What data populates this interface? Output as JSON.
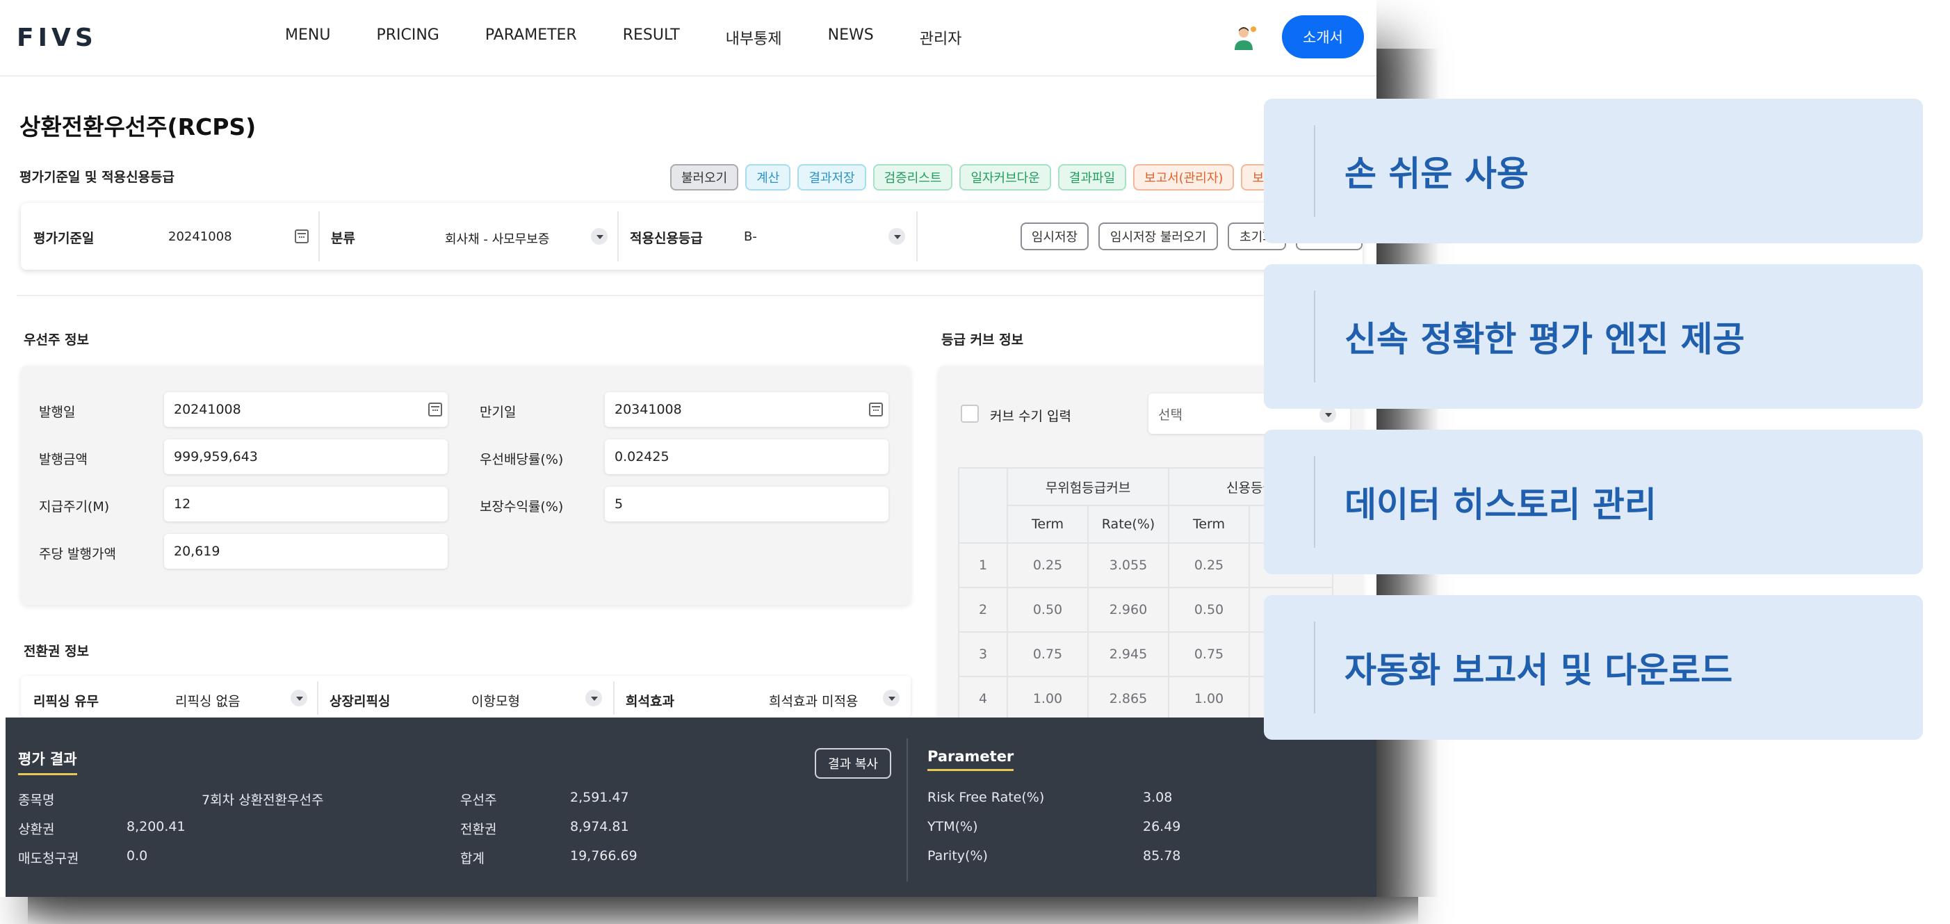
{
  "app": {
    "logo": "FIVS",
    "nav": [
      "MENU",
      "PRICING",
      "PARAMETER",
      "RESULT",
      "내부통제",
      "NEWS",
      "관리자"
    ],
    "intro_button": "소개서"
  },
  "page": {
    "title": "상환전환우선주(RCPS)",
    "section_top": "평가기준일 및 적용신용등급",
    "chips": [
      {
        "label": "불러오기",
        "style": "gray"
      },
      {
        "label": "계산",
        "style": "cyan"
      },
      {
        "label": "결과저장",
        "style": "cyan"
      },
      {
        "label": "검증리스트",
        "style": "green"
      },
      {
        "label": "일자커브다운",
        "style": "green"
      },
      {
        "label": "결과파일",
        "style": "green"
      },
      {
        "label": "보고서(관리자)",
        "style": "orange"
      },
      {
        "label": "보고서",
        "style": "orange"
      }
    ],
    "filter": {
      "eval_date_label": "평가기준일",
      "eval_date_value": "20241008",
      "category_label": "분류",
      "category_value": "회사채 - 사모무보증",
      "credit_label": "적용신용등급",
      "credit_value": "B-",
      "buttons": [
        "임시저장",
        "임시저장 불러오기",
        "초기화"
      ]
    },
    "preferred": {
      "title": "우선주 정보",
      "issue_date_label": "발행일",
      "issue_date_value": "20241008",
      "maturity_label": "만기일",
      "maturity_value": "20341008",
      "issue_amount_label": "발행금액",
      "issue_amount_value": "999,959,643",
      "dividend_label": "우선배당률(%)",
      "dividend_value": "0.02425",
      "period_label": "지급주기(M)",
      "period_value": "12",
      "guarantee_label": "보장수익률(%)",
      "guarantee_value": "5",
      "price_label": "주당 발행가액",
      "price_value": "20,619"
    },
    "grade_curve": {
      "title": "등급 커브 정보",
      "manual_label": "커브 수기 입력",
      "select_placeholder": "선택",
      "group1": "무위험등급커브",
      "group2": "신용등급",
      "col_term": "Term",
      "col_rate": "Rate(%)",
      "rows": [
        {
          "n": "1",
          "t1": "0.25",
          "r1": "3.055",
          "t2": "0.25"
        },
        {
          "n": "2",
          "t1": "0.50",
          "r1": "2.960",
          "t2": "0.50"
        },
        {
          "n": "3",
          "t1": "0.75",
          "r1": "2.945",
          "t2": "0.75"
        },
        {
          "n": "4",
          "t1": "1.00",
          "r1": "2.865",
          "t2": "1.00"
        }
      ]
    },
    "conversion": {
      "title": "전환권 정보",
      "refixing_label": "리픽싱 유무",
      "refixing_value": "리픽싱 없음",
      "listed_label": "상장리픽싱",
      "listed_value": "이항모형",
      "dilution_label": "희석효과",
      "dilution_value": "희석효과 미적용"
    }
  },
  "result": {
    "title": "평가 결과",
    "copy_button": "결과 복사",
    "name_label": "종목명",
    "name_value": "7회차 상환전환우선주",
    "preferred_label": "우선주",
    "preferred_value": "2,591.47",
    "redemption_label": "상환권",
    "redemption_value": "8,200.41",
    "conversion_label": "전환권",
    "conversion_value": "8,974.81",
    "put_label": "매도청구권",
    "put_value": "0.0",
    "total_label": "합계",
    "total_value": "19,766.69",
    "param_title": "Parameter",
    "rf_label": "Risk Free Rate(%)",
    "rf_value": "3.08",
    "ytm_label": "YTM(%)",
    "ytm_value": "26.49",
    "parity_label": "Parity(%)",
    "parity_value": "85.78"
  },
  "features": [
    "손 쉬운 사용",
    "신속 정확한 평가 엔진 제공",
    "데이터 히스토리 관리",
    "자동화 보고서 및 다운로드"
  ]
}
